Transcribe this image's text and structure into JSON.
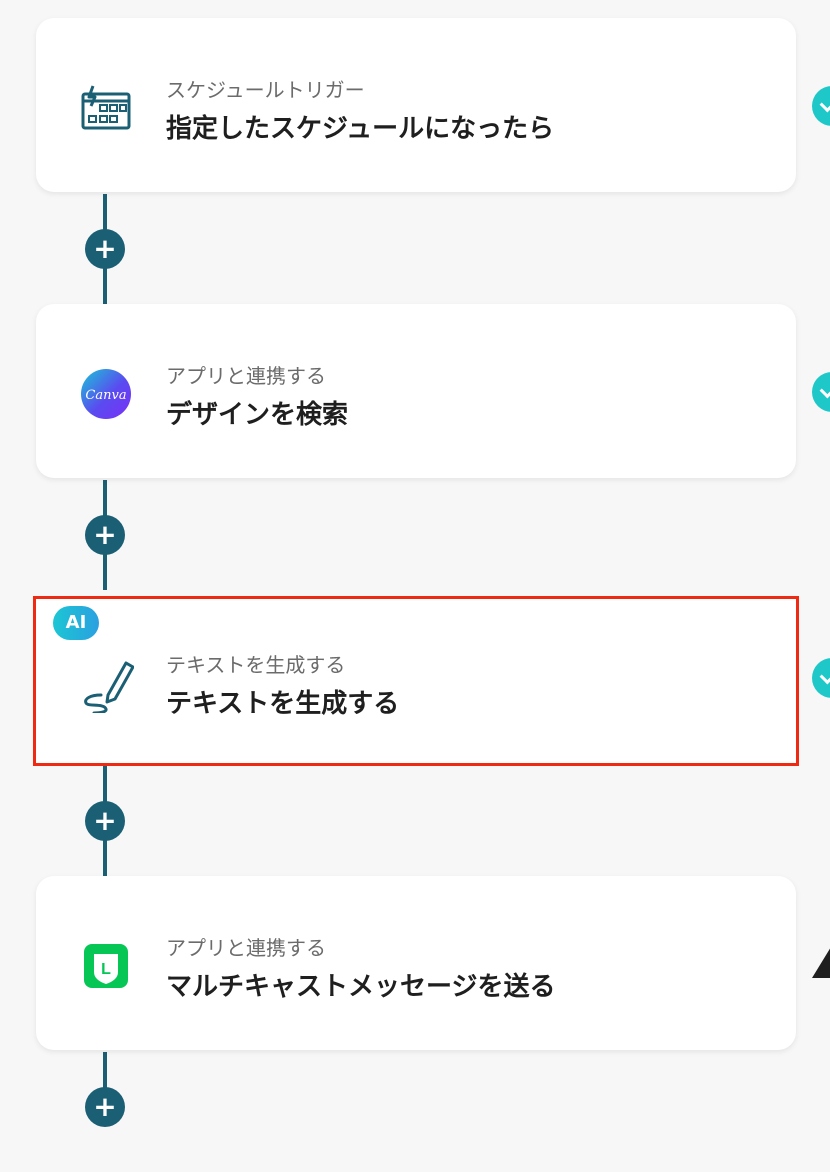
{
  "steps": [
    {
      "subtitle": "スケジュールトリガー",
      "title": "指定したスケジュールになったら",
      "icon": "calendar-clock-icon"
    },
    {
      "subtitle": "アプリと連携する",
      "title": "デザインを検索",
      "icon": "canva-icon",
      "icon_text": "Canva"
    },
    {
      "subtitle": "テキストを生成する",
      "title": "テキストを生成する",
      "icon": "pen-icon",
      "badge": "AI"
    },
    {
      "subtitle": "アプリと連携する",
      "title": "マルチキャストメッセージを送る",
      "icon": "line-icon",
      "icon_text": "L"
    }
  ],
  "plus_label": "+",
  "colors": {
    "accent": "#1b5f75",
    "selection": "#ee2a12",
    "status": "#1ec8c8"
  }
}
